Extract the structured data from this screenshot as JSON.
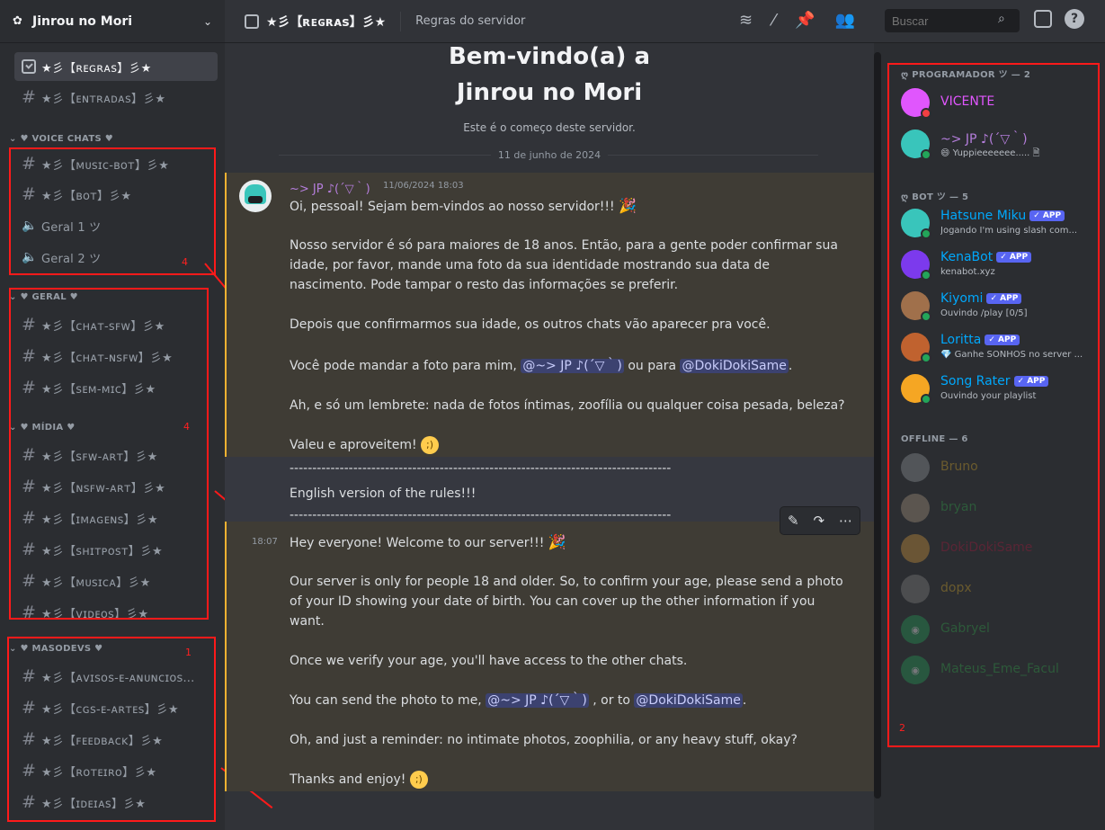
{
  "server": {
    "name": "Jinrou no Mori",
    "logo_icon": "gear-icon"
  },
  "channel": {
    "title": "★彡【ʀᴇɢʀᴀꜱ】彡★",
    "topic": "Regras do servidor"
  },
  "search": {
    "placeholder": "Buscar"
  },
  "sidebar": {
    "top_channels": [
      {
        "name": "★彡【ʀᴇɢʀᴀꜱ】彡★",
        "type": "rules",
        "active": true
      },
      {
        "name": "★彡【ᴇɴᴛʀᴀᴅᴀꜱ】彡★",
        "type": "text"
      }
    ],
    "categories": [
      {
        "label": "♥ VOICE CHATS ♥",
        "channels": [
          {
            "name": "★彡【ᴍᴜꜱɪᴄ-ʙᴏᴛ】彡★",
            "type": "text"
          },
          {
            "name": "★彡【ʙᴏᴛ】彡★",
            "type": "text"
          },
          {
            "name": "Geral 1 ツ",
            "type": "voice"
          },
          {
            "name": "Geral 2 ツ",
            "type": "voice"
          }
        ]
      },
      {
        "label": "♥ GERAL ♥",
        "channels": [
          {
            "name": "★彡【ᴄʜᴀᴛ-ꜱꜰᴡ】彡★",
            "type": "text"
          },
          {
            "name": "★彡【ᴄʜᴀᴛ-ɴꜱꜰᴡ】彡★",
            "type": "nsfw"
          },
          {
            "name": "★彡【ꜱᴇᴍ-ᴍɪᴄ】彡★",
            "type": "text"
          }
        ]
      },
      {
        "label": "♥ MÍDIA ♥",
        "channels": [
          {
            "name": "★彡【ꜱꜰᴡ-ᴀʀᴛ】彡★",
            "type": "text"
          },
          {
            "name": "★彡【ɴꜱꜰᴡ-ᴀʀᴛ】彡★",
            "type": "nsfw"
          },
          {
            "name": "★彡【ɪᴍᴀɢᴇɴꜱ】彡★",
            "type": "text"
          },
          {
            "name": "★彡【ꜱʜɪᴛᴘᴏꜱᴛ】彡★",
            "type": "text"
          },
          {
            "name": "★彡【ᴍᴜꜱɪᴄᴀ】彡★",
            "type": "text"
          },
          {
            "name": "★彡【ᴠɪᴅᴇᴏꜱ】彡★",
            "type": "text"
          }
        ]
      },
      {
        "label": "♥ MASODEVS ♥",
        "channels": [
          {
            "name": "★彡【ᴀᴠɪꜱᴏꜱ-ᴇ-ᴀɴᴜɴᴄɪᴏꜱ...",
            "type": "text"
          },
          {
            "name": "★彡【ᴄɢꜱ-ᴇ-ᴀʀᴛᴇꜱ】彡★",
            "type": "text"
          },
          {
            "name": "★彡【ꜰᴇᴇᴅʙᴀᴄᴋ】彡★",
            "type": "text"
          },
          {
            "name": "★彡【ʀᴏᴛᴇɪʀᴏ】彡★",
            "type": "text"
          },
          {
            "name": "★彡【ɪᴅᴇɪᴀꜱ】彡★",
            "type": "text"
          }
        ]
      }
    ]
  },
  "annotations": [
    "1",
    "2",
    "3",
    "4"
  ],
  "welcome": {
    "title_line1": "Bem-vindo(a) a",
    "title_line2": "Jinrou no Mori",
    "subtitle": "Este é o começo deste servidor.",
    "date_divider": "11 de junho de 2024"
  },
  "message": {
    "author": "~> JP ♪(´▽｀)",
    "timestamp": "11/06/2024 18:03",
    "p1": "Oi, pessoal! Sejam bem-vindos ao nosso servidor!!! ",
    "p2": "Nosso servidor é só para maiores de 18 anos. Então, para a gente poder confirmar sua idade, por favor, mande uma foto da sua identidade mostrando sua data de nascimento. Pode tampar o resto das informações se preferir.",
    "p3": "Depois que confirmarmos sua idade, os outros chats vão aparecer pra você.",
    "p4_pre": "Você pode mandar a foto para mim, ",
    "p4_mid": " ou para ",
    "p4_end": ".",
    "mention_jp": "@~> JP ♪(´▽｀)",
    "mention_doki": "@DokiDokiSame",
    "p5": "Ah, e só um lembrete: nada de fotos íntimas, zoofília ou qualquer coisa pesada, beleza?",
    "p6": "Valeu e aproveitem! ",
    "divider": "------------------------------------------------------------------------------------",
    "english_header": "English version of the rules!!!",
    "time2": "18:07",
    "e1": "Hey everyone! Welcome to our server!!! ",
    "e2": "Our server is only for people 18 and older. So, to confirm your age, please send a photo of your ID showing your date of birth. You can cover up the other information if you want.",
    "e3": "Once we verify your age, you'll have access to the other chats.",
    "e4_pre": "You can send the photo to me, ",
    "e4_mid": " , or to ",
    "e4_end": ".",
    "e5": "Oh, and just a reminder: no intimate photos, zoophilia, or any heavy stuff, okay?",
    "e6": "Thanks and enjoy! "
  },
  "members": {
    "roles": [
      {
        "label": "PROGRAMADOR ツ — 2"
      },
      {
        "label": "BOT ツ — 5"
      },
      {
        "label": "OFFLINE — 6"
      }
    ],
    "programadores": [
      {
        "name": "VICENTE",
        "color": "#e056fd",
        "status": "#f23f43",
        "sub": ""
      },
      {
        "name": "~> JP ♪(´▽｀)",
        "color": "#b57edc",
        "status": "#23a559",
        "sub": "😄 Yuppieeeeeee..... 🗎"
      }
    ],
    "bots": [
      {
        "name": "Hatsune Miku",
        "color": "#00a8fc",
        "sub": "Jogando I'm using slash com...",
        "av": "#39c5bb"
      },
      {
        "name": "KenaBot",
        "color": "#00a8fc",
        "sub": "kenabot.xyz",
        "av": "#7c3aed"
      },
      {
        "name": "Kiyomi",
        "color": "#00a8fc",
        "sub": "Ouvindo /play [0/5]",
        "av": "#a0704b"
      },
      {
        "name": "Loritta",
        "color": "#00a8fc",
        "sub": "💎 Ganhe SONHOS no server ...",
        "av": "#c0622f"
      },
      {
        "name": "Song Rater",
        "color": "#00a8fc",
        "sub": "Ouvindo your playlist",
        "av": "#f5a623"
      }
    ],
    "app_badge": "✓ APP",
    "offline": [
      {
        "name": "Bruno",
        "color": "#6b5b2e"
      },
      {
        "name": "bryan",
        "color": "#2d5a3a"
      },
      {
        "name": "DokiDokiSame",
        "color": "#5a2535"
      },
      {
        "name": "dopx",
        "color": "#6b5b2e"
      },
      {
        "name": "Gabryel",
        "color": "#2d5a3a"
      },
      {
        "name": "Mateus_Eme_Facul",
        "color": "#2d5a3a"
      }
    ]
  }
}
